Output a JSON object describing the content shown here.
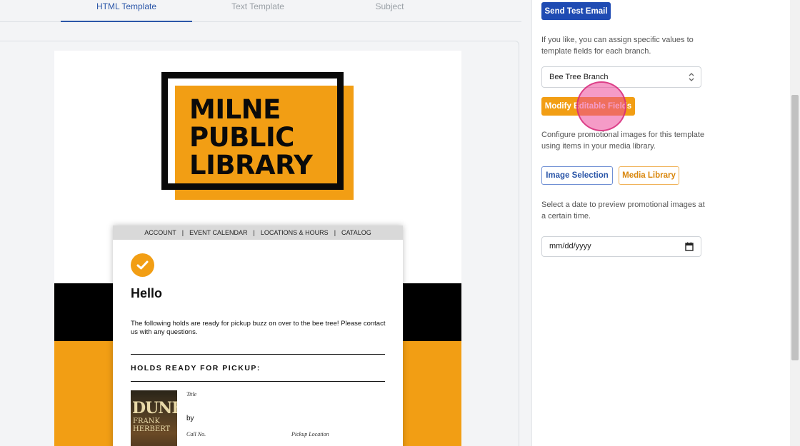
{
  "tabs": [
    {
      "label": "HTML Template",
      "active": true
    },
    {
      "label": "Text Template",
      "active": false
    },
    {
      "label": "Subject",
      "active": false
    }
  ],
  "email_preview": {
    "logo_text": [
      "MILNE",
      "PUBLIC",
      "LIBRARY"
    ],
    "nav": [
      "ACCOUNT",
      "EVENT CALENDAR",
      "LOCATIONS & HOURS",
      "CATALOG"
    ],
    "nav_separator": "|",
    "greeting": "Hello",
    "intro": "The following holds are ready for pickup buzz on over to the bee tree! Please contact us with any questions.",
    "holds_heading": "HOLDS READY FOR PICKUP:",
    "item": {
      "cover_title": "DUNE",
      "cover_author": "FRANK HERBERT",
      "title_label": "Title",
      "by_label": "by",
      "call_no_label": "Call No.",
      "pickup_label": "Pickup Location"
    }
  },
  "sidebar": {
    "send_test_label": "Send Test Email",
    "branch_help": "If you like, you can assign specific values to template fields for each branch.",
    "branch_selected": "Bee Tree Branch",
    "modify_label": "Modify Editable Fields",
    "promo_help": "Configure promotional images for this template using items in your media library.",
    "image_selection_label": "Image Selection",
    "media_library_label": "Media Library",
    "date_help": "Select a date to preview promotional images at a certain time.",
    "date_placeholder": "mm/dd/yyyy"
  },
  "colors": {
    "accent_orange": "#f29e14",
    "primary_blue": "#1f4bb3",
    "top_accent": "#e07c0a"
  }
}
